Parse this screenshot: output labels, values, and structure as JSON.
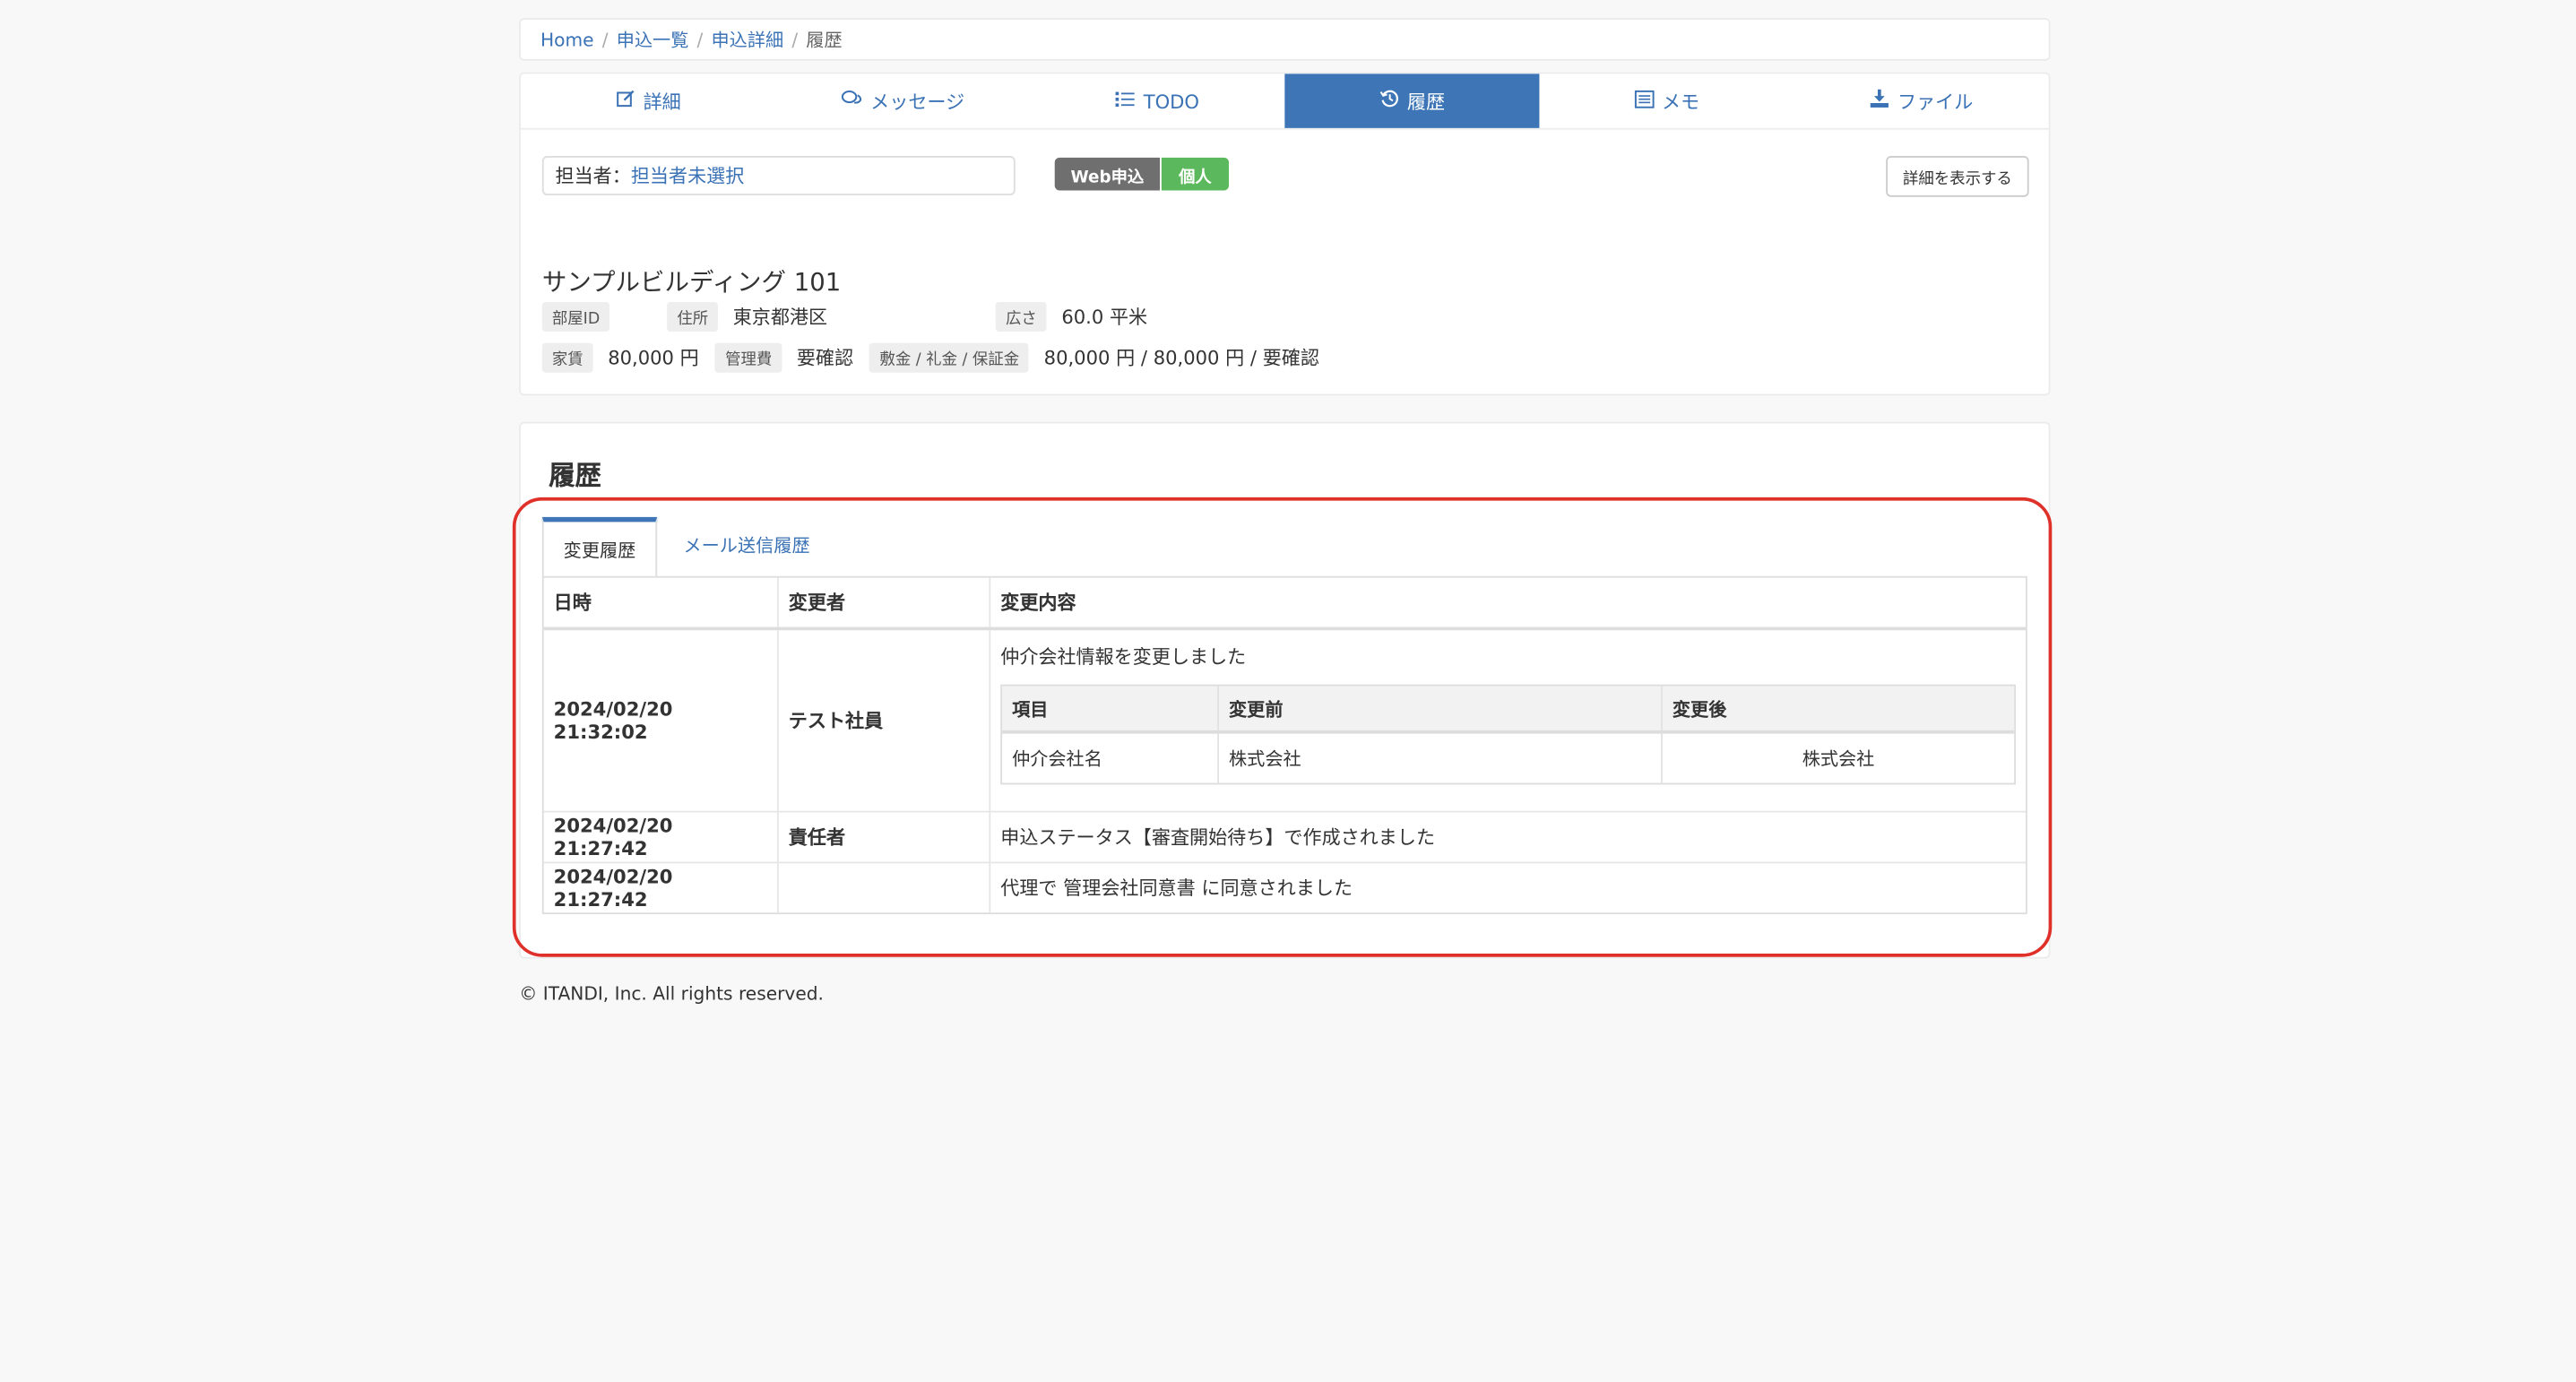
{
  "breadcrumb": [
    "Home",
    "申込一覧",
    "申込詳細",
    "履歴"
  ],
  "tabs": [
    {
      "label": "詳細",
      "icon": "edit-icon"
    },
    {
      "label": "メッセージ",
      "icon": "chat-icon"
    },
    {
      "label": "TODO",
      "icon": "list-icon"
    },
    {
      "label": "履歴",
      "icon": "history-icon",
      "active": true
    },
    {
      "label": "メモ",
      "icon": "memo-icon"
    },
    {
      "label": "ファイル",
      "icon": "download-icon"
    }
  ],
  "assignee": {
    "label": "担当者：",
    "value": "担当者未選択"
  },
  "badges": {
    "web": "Web申込",
    "kojin": "個人"
  },
  "detail_button": "詳細を表示する",
  "property": {
    "title": "サンプルビルディング 101",
    "room_id_label": "部屋ID",
    "room_id_value": "",
    "address_label": "住所",
    "address_value": "東京都港区",
    "area_label": "広さ",
    "area_value": "60.0 平米",
    "rent_label": "家賃",
    "rent_value": "80,000 円",
    "mgmt_label": "管理費",
    "mgmt_value": "要確認",
    "deposit_label": "敷金 / 礼金 / 保証金",
    "deposit_value": "80,000 円 / 80,000 円 / 要確認"
  },
  "history": {
    "title": "履歴",
    "subtabs": [
      "変更履歴",
      "メール送信履歴"
    ],
    "columns": [
      "日時",
      "変更者",
      "変更内容"
    ],
    "rows": [
      {
        "datetime": "2024/02/20 21:32:02",
        "user": "テスト社員",
        "content": "仲介会社情報を変更しました",
        "detail": {
          "columns": [
            "項目",
            "変更前",
            "変更後"
          ],
          "item": "仲介会社名",
          "before": "株式会社",
          "after": "株式会社"
        }
      },
      {
        "datetime": "2024/02/20 21:27:42",
        "user": "責任者",
        "content": "申込ステータス【審査開始待ち】で作成されました"
      },
      {
        "datetime": "2024/02/20 21:27:42",
        "user": "",
        "content": "代理で 管理会社同意書 に同意されました"
      }
    ]
  },
  "footer": "© ITANDI, Inc. All rights reserved.",
  "colors": {
    "accent": "#3d75b7",
    "highlight_frame": "#e0302a",
    "badge_web": "#6f6f6f",
    "badge_kojin": "#5cb85c"
  }
}
